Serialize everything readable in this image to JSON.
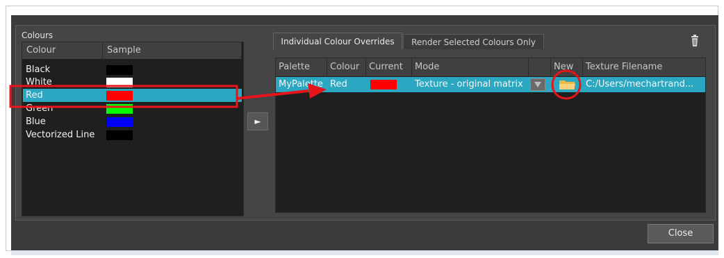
{
  "colours_panel": {
    "group_label": "Colours",
    "columns": [
      "Colour",
      "Sample"
    ],
    "rows": [
      {
        "name": "Black",
        "swatch": "#000000"
      },
      {
        "name": "White",
        "swatch": "#ffffff"
      },
      {
        "name": "Red",
        "swatch": "#ff0000",
        "selected": true
      },
      {
        "name": "Green",
        "swatch": "#00ff00"
      },
      {
        "name": "Blue",
        "swatch": "#0000ff"
      },
      {
        "name": "Vectorized Line",
        "swatch": "#000000"
      }
    ]
  },
  "add_button": {
    "label": "►"
  },
  "tabs": [
    {
      "label": "Individual Colour Overrides",
      "active": true
    },
    {
      "label": "Render Selected Colours Only",
      "active": false
    }
  ],
  "trash_icon": "trash-icon",
  "overrides_table": {
    "columns": [
      "Palette",
      "Colour",
      "Current",
      "Mode",
      "",
      "New",
      "Texture Filename"
    ],
    "row": {
      "palette": "MyPalette",
      "colour": "Red",
      "current_swatch": "#ff0000",
      "mode": "Texture - original matrix",
      "texture_filename": "C:/Users/mechartrand..."
    }
  },
  "close_button": {
    "label": "Close"
  },
  "colors": {
    "selection": "#2aa7c1",
    "dialog_bg": "#3c3c3c",
    "list_bg": "#1f1f1f",
    "annotation": "#e8141b"
  }
}
